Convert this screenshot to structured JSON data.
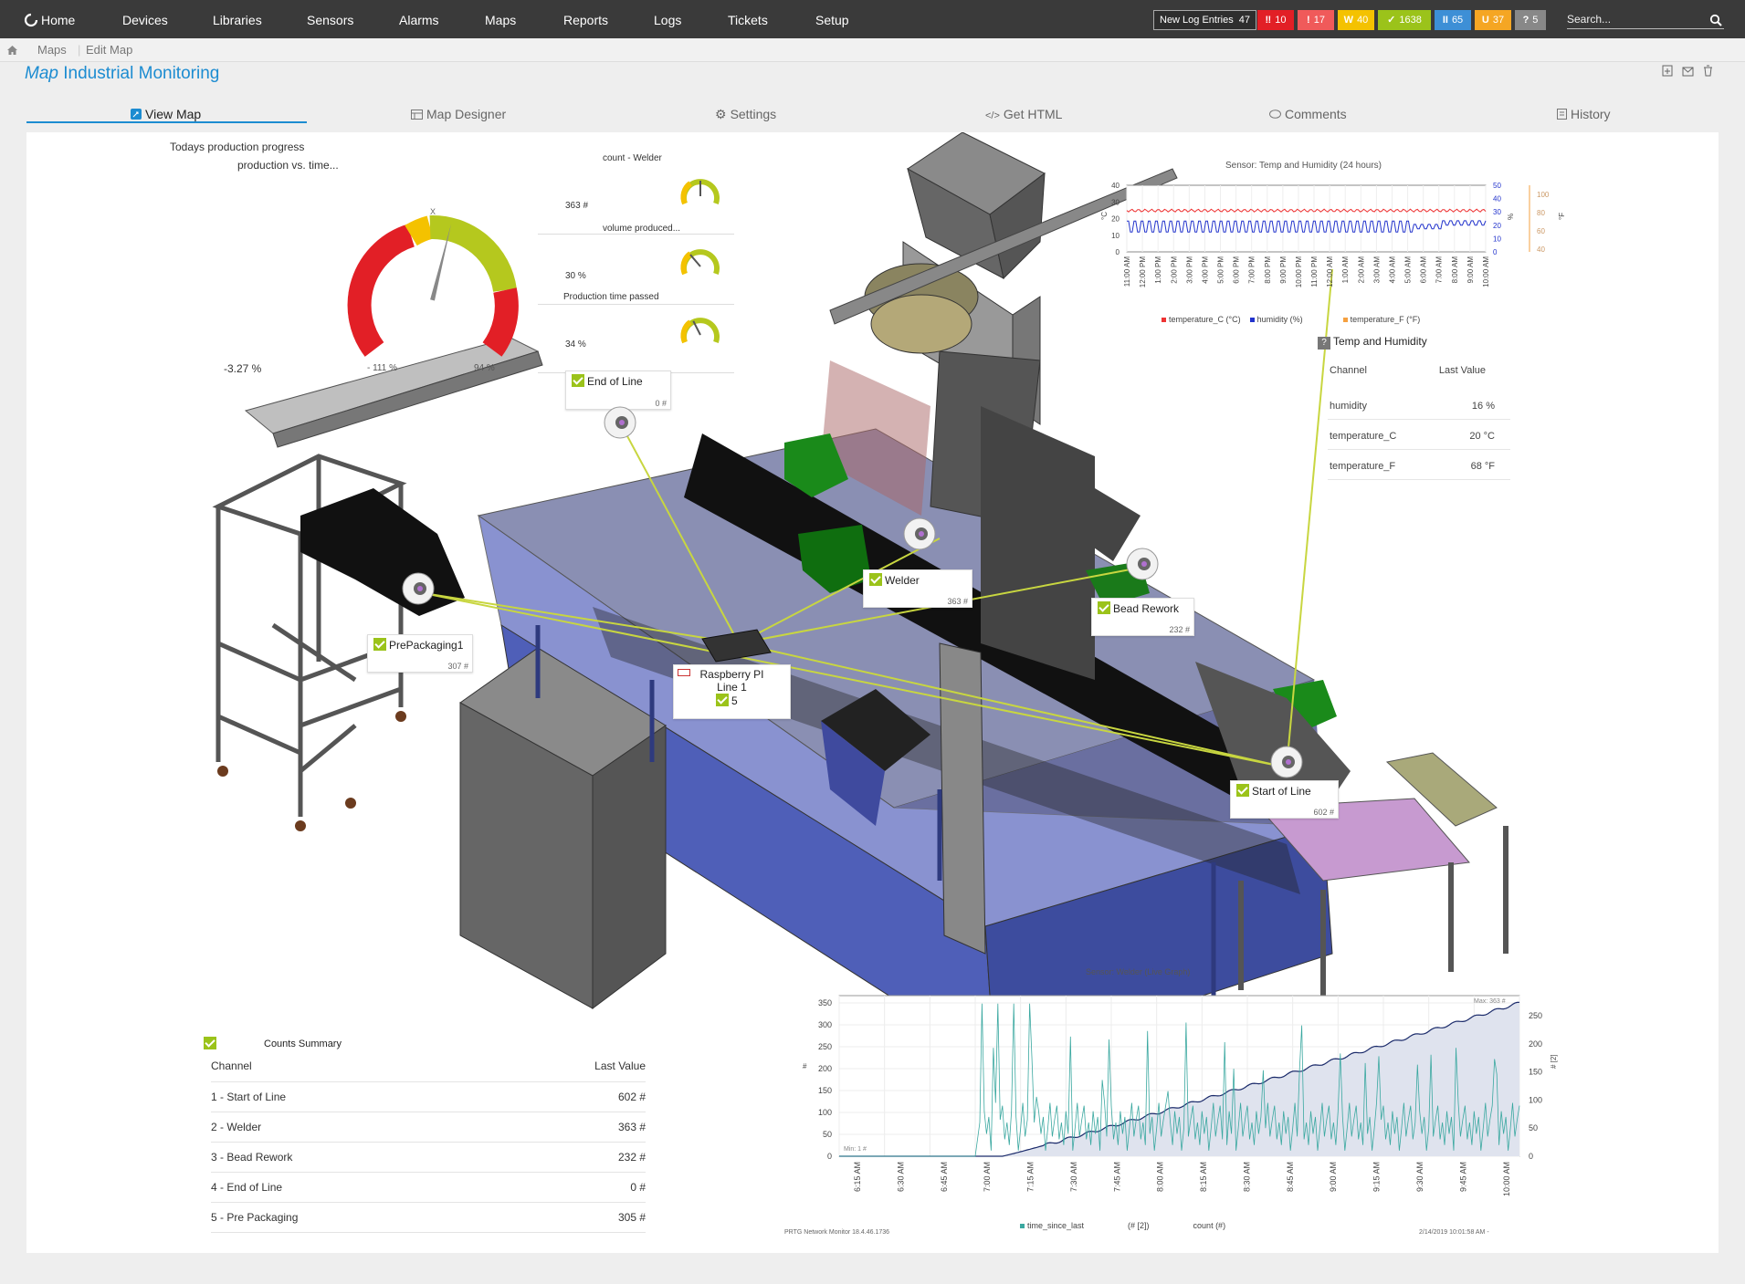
{
  "nav": {
    "home": "Home",
    "items": [
      "Devices",
      "Libraries",
      "Sensors",
      "Alarms",
      "Maps",
      "Reports",
      "Logs",
      "Tickets",
      "Setup"
    ],
    "newlog_label": "New Log Entries",
    "newlog_count": "47",
    "badges": [
      {
        "sym": "‼",
        "n": "10",
        "color": "#e21f26"
      },
      {
        "sym": "!",
        "n": "17",
        "color": "#f05a5a"
      },
      {
        "sym": "W",
        "n": "40",
        "color": "#f4c200"
      },
      {
        "sym": "✓",
        "n": "1638",
        "color": "#9bc31a"
      },
      {
        "sym": "II",
        "n": "65",
        "color": "#3d8fd6"
      },
      {
        "sym": "U",
        "n": "37",
        "color": "#f5a623"
      },
      {
        "sym": "?",
        "n": "5",
        "color": "#888888"
      }
    ],
    "search_placeholder": "Search..."
  },
  "breadcrumb": {
    "items": [
      "Maps",
      "Edit Map"
    ]
  },
  "page": {
    "title_prefix": "Map",
    "title": "Industrial Monitoring"
  },
  "tabs": [
    "View Map",
    "Map Designer",
    "Settings",
    "Get HTML",
    "Comments",
    "History"
  ],
  "gauge_main": {
    "title": "Todays production progress",
    "subtitle": "production vs. time...",
    "left": "-3.27 %",
    "center": "- 111 %",
    "right": "94 %",
    "marker": "X",
    "value": 0.55
  },
  "mini_gauges": [
    {
      "title": "count - Welder",
      "value": "363 #",
      "level": 0.5
    },
    {
      "title": "volume produced...",
      "value": "30 %",
      "level": 0.35
    },
    {
      "title": "Production time passed",
      "value": "34 %",
      "level": 0.4
    }
  ],
  "temp_chart": {
    "title": "Sensor: Temp and Humidity (24 hours)",
    "left_ticks": [
      "40",
      "30",
      "20",
      "10",
      "0"
    ],
    "mid_ticks": [
      "50",
      "40",
      "30",
      "20",
      "10",
      "0"
    ],
    "right_ticks": [
      "100",
      "80",
      "60",
      "40"
    ],
    "left_unit": "°C",
    "mid_unit": "%",
    "right_unit": "°F",
    "x_labels": [
      "11:00 AM",
      "12:00 PM",
      "1:00 PM",
      "2:00 PM",
      "3:00 PM",
      "4:00 PM",
      "5:00 PM",
      "6:00 PM",
      "7:00 PM",
      "8:00 PM",
      "9:00 PM",
      "10:00 PM",
      "11:00 PM",
      "12:00 AM",
      "1:00 AM",
      "2:00 AM",
      "3:00 AM",
      "4:00 AM",
      "5:00 AM",
      "6:00 AM",
      "7:00 AM",
      "8:00 AM",
      "9:00 AM",
      "10:00 AM"
    ],
    "legend": [
      "temperature_C (°C)",
      "humidity (%)",
      "temperature_F (°F)"
    ],
    "colors": {
      "temp_c": "#e33",
      "humidity": "#2233cc",
      "temp_f": "#f5a040"
    }
  },
  "temp_table": {
    "title": "Temp and Humidity",
    "col_channel": "Channel",
    "col_last": "Last Value",
    "rows": [
      {
        "ch": "humidity",
        "v": "16 %"
      },
      {
        "ch": "temperature_C",
        "v": "20 °C"
      },
      {
        "ch": "temperature_F",
        "v": "68 °F"
      }
    ]
  },
  "sensors": {
    "end_of_line": {
      "name": "End of Line",
      "val": "0 #"
    },
    "welder": {
      "name": "Welder",
      "val": "363 #"
    },
    "bead_rework": {
      "name": "Bead Rework",
      "val": "232 #"
    },
    "prepackaging": {
      "name": "PrePackaging1",
      "val": "307 #"
    },
    "start_of_line": {
      "name": "Start of Line",
      "val": "602 #"
    },
    "raspberry": {
      "name_line1": "Raspberry PI",
      "name_line2": "Line 1",
      "count": "5"
    }
  },
  "counts": {
    "title": "Counts Summary",
    "col_channel": "Channel",
    "col_last": "Last Value",
    "rows": [
      {
        "ch": "1 - Start of Line",
        "v": "602 #"
      },
      {
        "ch": "2 - Welder",
        "v": "363 #"
      },
      {
        "ch": "3 - Bead Rework",
        "v": "232 #"
      },
      {
        "ch": "4 - End of Line",
        "v": "0 #"
      },
      {
        "ch": "5 - Pre Packaging",
        "v": "305 #"
      }
    ]
  },
  "welder_chart": {
    "title": "Sensor: Welder (Live Graph)",
    "left_ticks": [
      "350",
      "300",
      "250",
      "200",
      "150",
      "100",
      "50",
      "0"
    ],
    "right_ticks": [
      "250",
      "200",
      "150",
      "100",
      "50",
      "0"
    ],
    "left_unit": "#",
    "right_unit": "# [2]",
    "x_labels": [
      "6:15 AM",
      "6:30 AM",
      "6:45 AM",
      "7:00 AM",
      "7:15 AM",
      "7:30 AM",
      "7:45 AM",
      "8:00 AM",
      "8:15 AM",
      "8:30 AM",
      "8:45 AM",
      "9:00 AM",
      "9:15 AM",
      "9:30 AM",
      "9:45 AM",
      "10:00 AM"
    ],
    "legend": [
      "time_since_last",
      "(# [2])",
      "count (#)"
    ],
    "max_label": "Max: 363 #",
    "min_label": "Min: 1 #",
    "footer_left": "PRTG Network Monitor 18.4.46.1736",
    "footer_right": "2/14/2019 10:01:58 AM -",
    "colors": {
      "spikes": "#3aa8a0",
      "count": "#1a2a6a"
    }
  }
}
